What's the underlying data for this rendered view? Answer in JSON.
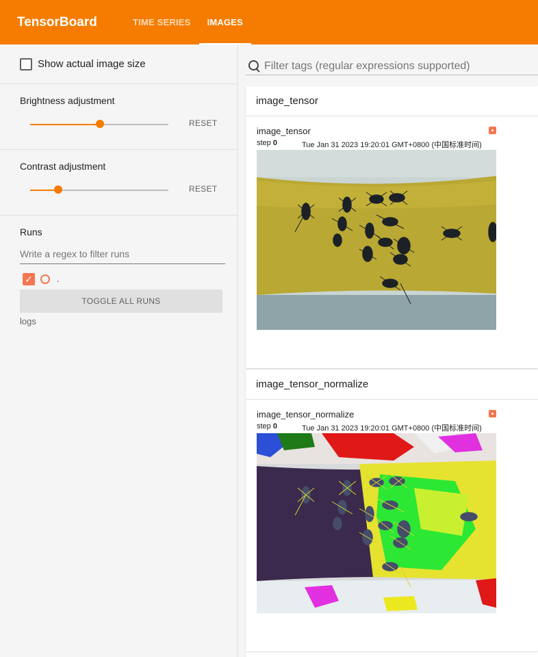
{
  "header": {
    "brand": "TensorBoard",
    "tabs": [
      {
        "label": "TIME SERIES",
        "active": false
      },
      {
        "label": "IMAGES",
        "active": true
      }
    ]
  },
  "sidebar": {
    "show_actual_size_label": "Show actual image size",
    "brightness": {
      "label": "Brightness adjustment",
      "reset_label": "RESET",
      "value": 0.5
    },
    "contrast": {
      "label": "Contrast adjustment",
      "reset_label": "RESET",
      "value": 0.2
    },
    "runs": {
      "title": "Runs",
      "filter_placeholder": "Write a regex to filter runs",
      "items": [
        {
          "name": ".",
          "checked": true,
          "color": "#f4754f"
        }
      ],
      "toggle_all_label": "TOGGLE ALL RUNS",
      "logdir": "logs"
    }
  },
  "main": {
    "filter_placeholder": "Filter tags (regular expressions supported)",
    "groups": [
      {
        "name": "image_tensor",
        "card": {
          "title": "image_tensor",
          "step_label": "step",
          "step": "0",
          "time": "Tue Jan 31 2023 19:20:01 GMT+0800 (中国标准时间)"
        }
      },
      {
        "name": "image_tensor_normalize",
        "card": {
          "title": "image_tensor_normalize",
          "step_label": "step",
          "step": "0",
          "time": "Tue Jan 31 2023 19:20:01 GMT+0800 (中国标准时间)"
        }
      }
    ]
  },
  "colors": {
    "accent": "#f57c00",
    "run": "#f4754f"
  }
}
